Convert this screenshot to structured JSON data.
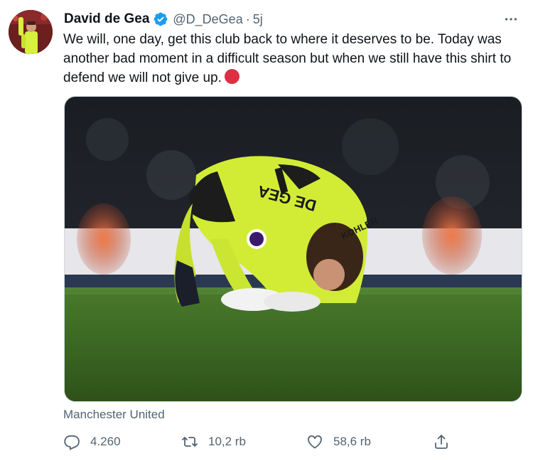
{
  "tweet": {
    "author_name": "David de Gea",
    "handle": "@D_DeGea",
    "separator": "·",
    "timestamp": "5j",
    "text": "We will, one day, get this club back to where it deserves to be. Today was another bad moment in a difficult season but when we still have this shirt to defend we will not give up.",
    "location": "Manchester United",
    "jersey_name": "DE GEA",
    "jersey_sponsor": "KOHLER"
  },
  "actions": {
    "reply_count": "4.260",
    "retweet_count": "10,2 rb",
    "like_count": "58,6 rb"
  },
  "icons": {
    "verified": "verified-badge-icon",
    "more": "more-icon",
    "reply": "reply-icon",
    "retweet": "retweet-icon",
    "like": "heart-icon",
    "share": "share-icon"
  },
  "colors": {
    "verified_blue": "#1d9bf0",
    "secondary_text": "#536471",
    "red_circle": "#dd2e44",
    "pitch_green": "#3d6b24",
    "jersey_yellow": "#d7ef3d"
  }
}
